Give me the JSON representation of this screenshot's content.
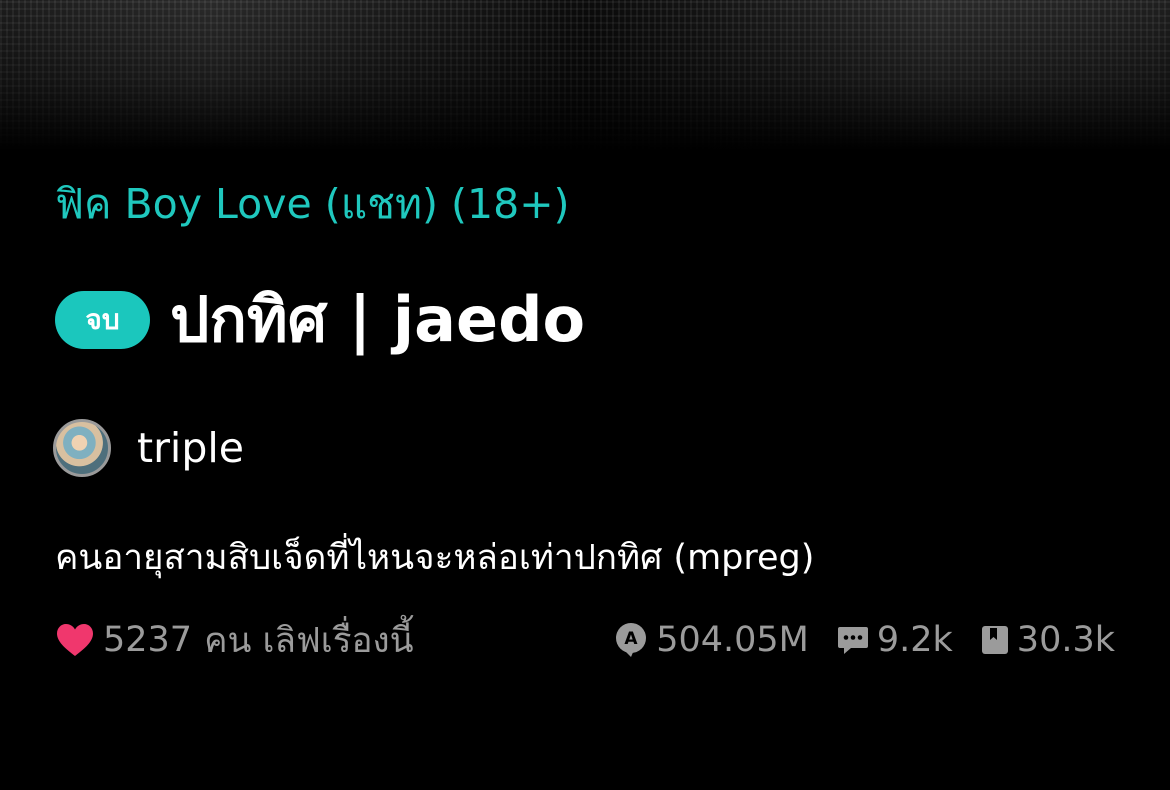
{
  "category": "ฟิค Boy Love (แชท) (18+)",
  "status_badge": "จบ",
  "title": "ปกทิศ | jaedo",
  "author": {
    "name": "triple"
  },
  "synopsis": "คนอายุสามสิบเจ็ดที่ไหนจะหล่อเท่าปกทิศ (mpreg)",
  "stats": {
    "love_count": "5237",
    "love_suffix": "คน เลิฟเรื่องนี้",
    "views": "504.05M",
    "comments": "9.2k",
    "bookmarks": "30.3k"
  },
  "colors": {
    "accent": "#1fc8be",
    "heart": "#f0376d",
    "muted": "#9b9b9b",
    "background": "#000000"
  },
  "icons": {
    "love": "heart-icon",
    "views": "read-count-icon",
    "comments": "comment-icon",
    "bookmarks": "bookmark-icon"
  }
}
